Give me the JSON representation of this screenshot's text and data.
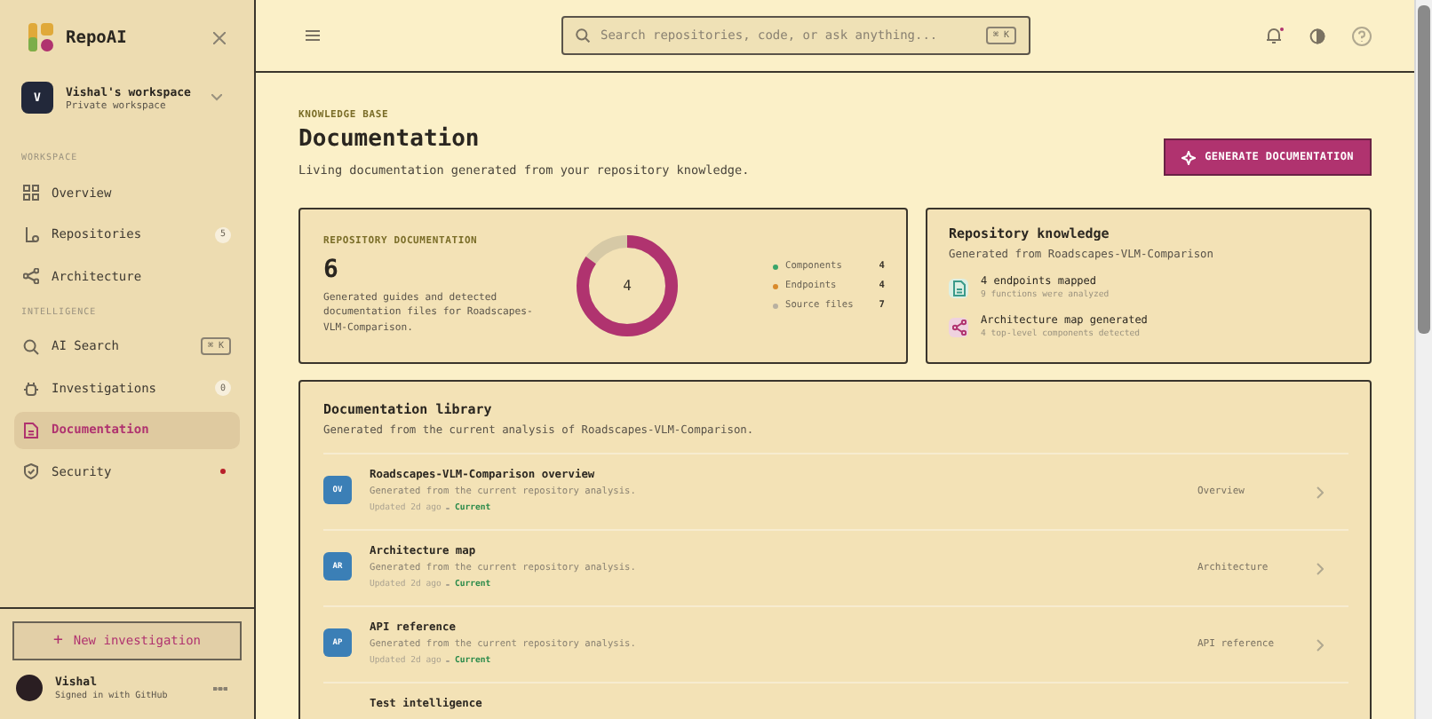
{
  "sidebar": {
    "brand": "RepoAI",
    "workspace": {
      "initial": "V",
      "name": "Vishal's workspace",
      "subtitle": "Private workspace"
    },
    "sections": [
      {
        "title": "WORKSPACE",
        "items": [
          {
            "label": "Overview",
            "selected": false
          },
          {
            "label": "Repositories",
            "badge": "5",
            "selected": false
          },
          {
            "label": "Architecture",
            "selected": false
          }
        ]
      },
      {
        "title": "INTELLIGENCE",
        "items": [
          {
            "label": "AI Search",
            "shortcut": "⌘ K",
            "selected": false
          },
          {
            "label": "Investigations",
            "badge": "0",
            "selected": false
          },
          {
            "label": "Documentation",
            "selected": true
          },
          {
            "label": "Security",
            "alert": true,
            "selected": false
          }
        ]
      }
    ],
    "new_button": "New investigation",
    "new_button_icon": "+",
    "user": {
      "name": "Vishal",
      "subtitle": "Signed in with GitHub"
    }
  },
  "topbar": {
    "search_placeholder": "Search repositories, code, or ask anything...",
    "shortcut": "⌘ K"
  },
  "header": {
    "eyebrow": "KNOWLEDGE BASE",
    "title": "Documentation",
    "subtitle": "Living documentation generated from your repository knowledge.",
    "button": "GENERATE DOCUMENTATION"
  },
  "doc_card": {
    "eyebrow": "REPOSITORY DOCUMENTATION",
    "count": "6",
    "description": "Generated guides and detected documentation files for Roadscapes-VLM-Comparison.",
    "donut_center": "4",
    "legend": [
      {
        "label": "Components",
        "value": "4",
        "color": "#3aa56a"
      },
      {
        "label": "Endpoints",
        "value": "4",
        "color": "#d98a2b"
      },
      {
        "label": "Source files",
        "value": "7",
        "color": "#b8b0a0"
      }
    ]
  },
  "knowledge": {
    "title": "Repository knowledge",
    "subtitle": "Generated from Roadscapes-VLM-Comparison",
    "items": [
      {
        "kind": "file",
        "title": "4 endpoints mapped",
        "detail": "9 functions were analyzed"
      },
      {
        "kind": "share",
        "title": "Architecture map generated",
        "detail": "4 top-level components detected"
      }
    ]
  },
  "library": {
    "title": "Documentation library",
    "subtitle": "Generated from the current analysis of Roadscapes-VLM-Comparison.",
    "rows": [
      {
        "badge": "OV",
        "title": "Roadscapes-VLM-Comparison overview",
        "description": "Generated from the current repository analysis.",
        "updated": "Updated 2d ago",
        "status": "Current",
        "category": "Overview"
      },
      {
        "badge": "AR",
        "title": "Architecture map",
        "description": "Generated from the current repository analysis.",
        "updated": "Updated 2d ago",
        "status": "Current",
        "category": "Architecture"
      },
      {
        "badge": "AP",
        "title": "API reference",
        "description": "Generated from the current repository analysis.",
        "updated": "Updated 2d ago",
        "status": "Current",
        "category": "API reference"
      },
      {
        "title": "Test intelligence"
      }
    ]
  }
}
